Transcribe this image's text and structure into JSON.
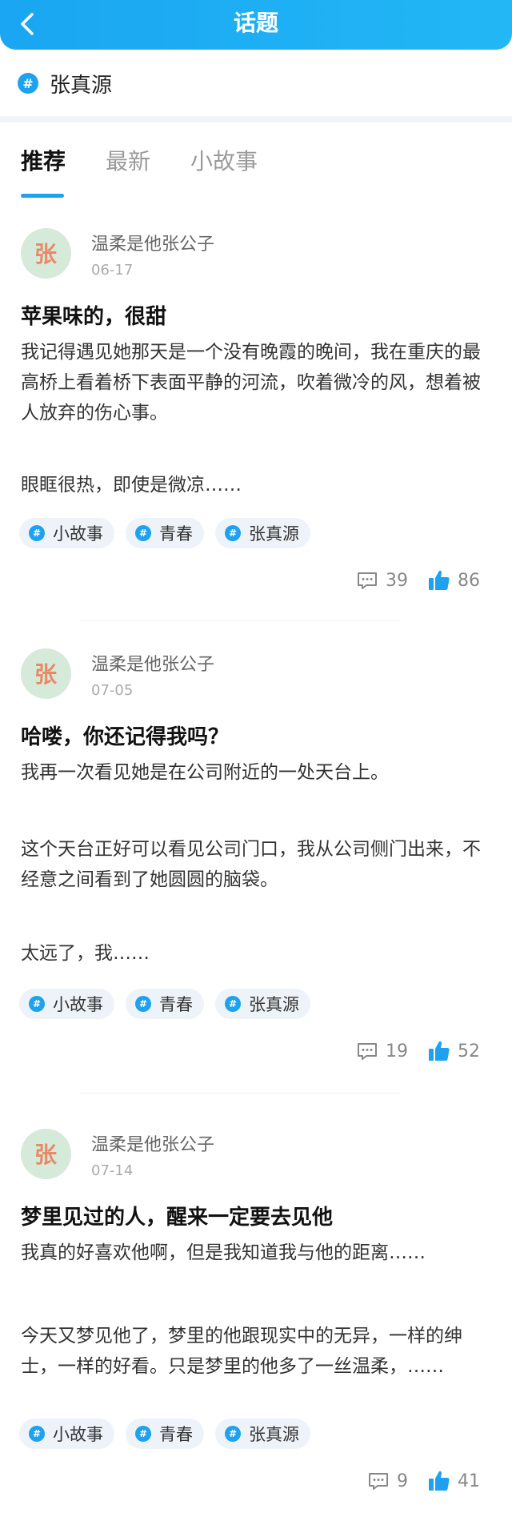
{
  "header": {
    "title": "话题"
  },
  "topic": {
    "name": "张真源"
  },
  "tabs": [
    "推荐",
    "最新",
    "小故事"
  ],
  "avatar_text": "张",
  "colors": {
    "brand": "#1ea2f0",
    "avatar_bg": "#d6ead9",
    "avatar_text": "#e8896a"
  },
  "posts": [
    {
      "author": "温柔是他张公子",
      "date": "06-17",
      "title": "苹果味的，很甜",
      "paragraphs": [
        "我记得遇见她那天是一个没有晚霞的晚间，我在重庆的最高桥上看着桥下表面平静的河流，吹着微冷的风，想着被人放弃的伤心事。",
        "眼眶很热，即使是微凉……"
      ],
      "tags": [
        "小故事",
        "青春",
        "张真源"
      ],
      "comments": "39",
      "likes": "86"
    },
    {
      "author": "温柔是他张公子",
      "date": "07-05",
      "title": "哈喽，你还记得我吗？",
      "paragraphs": [
        "我再一次看见她是在公司附近的一处天台上。",
        "这个天台正好可以看见公司门口，我从公司侧门出来，不经意之间看到了她圆圆的脑袋。",
        "太远了，我……"
      ],
      "tags": [
        "小故事",
        "青春",
        "张真源"
      ],
      "comments": "19",
      "likes": "52"
    },
    {
      "author": "温柔是他张公子",
      "date": "07-14",
      "title": "梦里见过的人，醒来一定要去见他",
      "paragraphs": [
        "我真的好喜欢他啊，但是我知道我与他的距离……",
        "今天又梦见他了，梦里的他跟现实中的无异，一样的绅士，一样的好看。只是梦里的他多了一丝温柔，……"
      ],
      "tags": [
        "小故事",
        "青春",
        "张真源"
      ],
      "comments": "9",
      "likes": "41"
    }
  ]
}
